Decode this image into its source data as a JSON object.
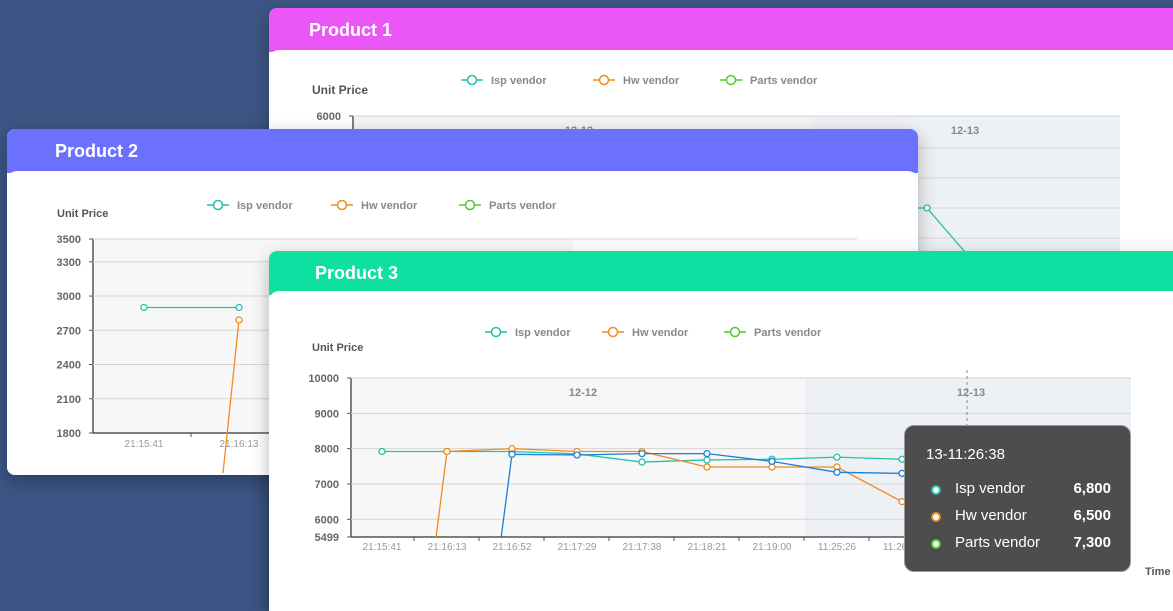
{
  "cards": [
    {
      "title": "Product 1",
      "color": "#ea57f6"
    },
    {
      "title": "Product 2",
      "color": "#6b70ff"
    },
    {
      "title": "Product 3",
      "color": "#0fe0a2"
    }
  ],
  "colors": {
    "isp": "#26c2a7",
    "hw": "#f28a1d",
    "parts": "#52cc2d",
    "blue": "#1c7fd8"
  },
  "chart_data": [
    {
      "type": "line",
      "title": "Product 1",
      "ylabel": "Unit Price",
      "ylim": [
        5499,
        6000
      ],
      "y_ticks": [
        6000
      ],
      "day_labels": [
        "12-12",
        "12-13"
      ],
      "series": [
        {
          "name": "Isp vendor"
        },
        {
          "name": "Hw vendor"
        },
        {
          "name": "Parts vendor"
        }
      ]
    },
    {
      "type": "line",
      "title": "Product 2",
      "ylabel": "Unit Price",
      "ylim": [
        1800,
        3500
      ],
      "y_ticks": [
        1800,
        2100,
        2400,
        2700,
        3000,
        3300,
        3500
      ],
      "x": [
        "21:15:41",
        "21:16:13"
      ],
      "series": [
        {
          "name": "Isp vendor",
          "values": [
            2900,
            2900
          ]
        },
        {
          "name": "Hw vendor",
          "values": [
            null,
            2790
          ]
        },
        {
          "name": "Parts vendor",
          "values": [
            null,
            null
          ]
        }
      ]
    },
    {
      "type": "line",
      "title": "Product 3",
      "ylabel": "Unit Price",
      "xlabel": "Time",
      "ylim": [
        5499,
        10000
      ],
      "y_ticks": [
        5499,
        6000,
        7000,
        8000,
        9000,
        10000
      ],
      "day_labels": [
        "12-12",
        "12-13"
      ],
      "x": [
        "21:15:41",
        "21:16:13",
        "21:16:52",
        "21:17:29",
        "21:17:38",
        "21:18:21",
        "21:19:00",
        "11:25:26",
        "11:26:38"
      ],
      "series": [
        {
          "name": "Isp vendor",
          "values": [
            7920,
            7920,
            7920,
            7850,
            7620,
            7680,
            7700,
            7760,
            7700
          ]
        },
        {
          "name": "Hw vendor",
          "values": [
            null,
            7920,
            8000,
            7920,
            7920,
            7480,
            7480,
            7480,
            6500
          ]
        },
        {
          "name": "Parts vendor",
          "values": [
            null,
            null,
            7840,
            7820,
            7860,
            7860,
            7640,
            7330,
            7300
          ]
        }
      ],
      "tooltip": {
        "time": "13-11:26:38",
        "rows": [
          {
            "name": "Isp vendor",
            "value": "6,800"
          },
          {
            "name": "Hw vendor",
            "value": "6,500"
          },
          {
            "name": "Parts vendor",
            "value": "7,300"
          }
        ]
      }
    }
  ]
}
